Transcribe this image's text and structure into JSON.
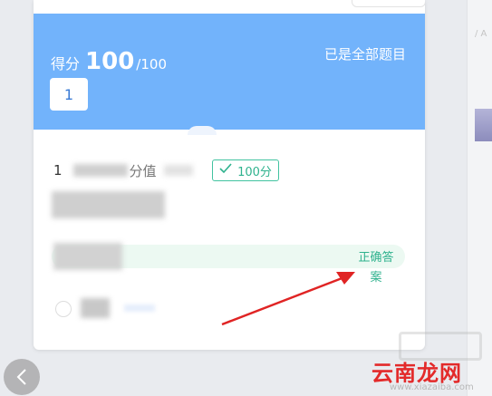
{
  "header": {
    "score_label": "得分",
    "score_value": "100",
    "score_total": "/100",
    "status": "已是全部题目",
    "question_chip": "1"
  },
  "question": {
    "number": "1",
    "title_fragment": "分值",
    "points_badge": "100分",
    "check_icon": "check-icon"
  },
  "answer": {
    "correct_label": "正确答案"
  },
  "right_panel": {
    "partial_text": "/ A"
  },
  "watermark": {
    "cn": "云南龙网",
    "en": "www.xiazaiba.com"
  },
  "colors": {
    "header_blue": "#72b3fb",
    "correct_green": "#2fb28e",
    "arrow_red": "#e02424"
  }
}
